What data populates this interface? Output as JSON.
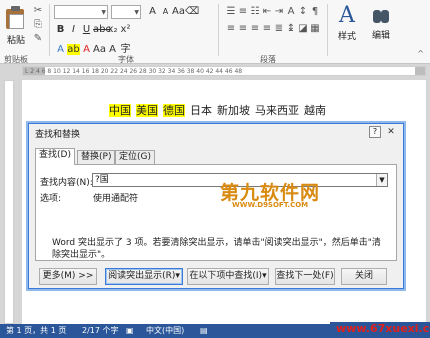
{
  "ribbon": {
    "paste_label": "粘贴",
    "clipboard_label": "剪贴板",
    "font_group_label": "字体",
    "paragraph_group_label": "段落",
    "styles_label": "样式",
    "editing_label": "编辑"
  },
  "document": {
    "words": [
      {
        "text": "中国",
        "highlight": true
      },
      {
        "text": "美国",
        "highlight": true
      },
      {
        "text": "德国",
        "highlight": true
      },
      {
        "text": "日本",
        "highlight": false
      },
      {
        "text": "新加坡",
        "highlight": false
      },
      {
        "text": "马来西亚",
        "highlight": false
      },
      {
        "text": "越南",
        "highlight": false
      }
    ],
    "highlight_color": "#ffff00"
  },
  "dialog": {
    "title": "查找和替换",
    "help": "?",
    "close": "✕",
    "tabs": [
      "查找(D)",
      "替换(P)",
      "定位(G)"
    ],
    "find_label": "查找内容(N):",
    "find_value": "?国",
    "options_label": "选项:",
    "options_value": "使用通配符",
    "message": "Word 突出显示了 3 项。若要清除突出显示，请单击\"阅读突出显示\"，然后单击\"清除突出显示\"。",
    "buttons": {
      "more": "更多(M) >>",
      "reading_highlight": "阅读突出显示(R)▾",
      "find_in": "在以下项中查找(I)▾",
      "find_next": "查找下一处(F)",
      "close": "关闭"
    },
    "watermark_title": "第九软件网",
    "watermark_url": "WWW.D9SOFT.COM"
  },
  "statusbar": {
    "page": "第 1 页，共 1 页",
    "words": "2/17 个字",
    "language": "中文(中国)",
    "watermark": "www.67xuexi.com"
  },
  "ruler": {
    "text": "L   2  4  6  8  10  12  14  16  18  20  22  24  26  28  30  32  34  36  38  40  42  44  46  48"
  }
}
